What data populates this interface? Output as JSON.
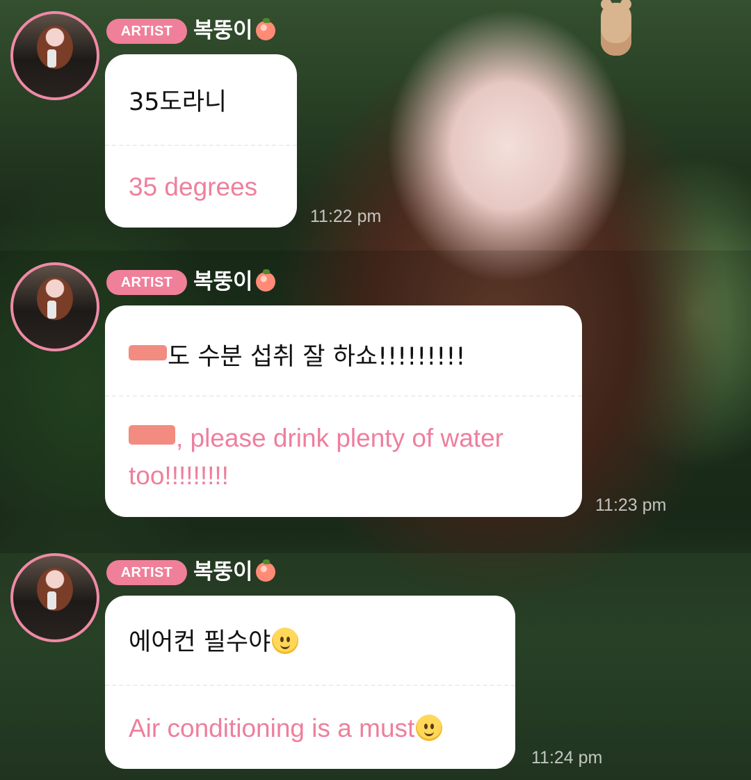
{
  "messages": [
    {
      "badge": "ARTIST",
      "nickname": "복뚱이",
      "original": "35도라니",
      "translation": "35 degrees",
      "timestamp": "11:22 pm"
    },
    {
      "badge": "ARTIST",
      "nickname": "복뚱이",
      "original": "도 수분 섭취 잘 하쇼!!!!!!!!!",
      "translation": ", please drink plenty of water too!!!!!!!!!",
      "timestamp": "11:23 pm"
    },
    {
      "badge": "ARTIST",
      "nickname": "복뚱이",
      "original": "에어컨 필수야",
      "translation": "Air conditioning is a must",
      "timestamp": "11:24 pm"
    }
  ],
  "icons": {
    "nickname_icon": "peach-icon",
    "emoji": "melting-face-icon"
  },
  "colors": {
    "accent": "#f07f9a",
    "translation": "#ee7f9c",
    "bubble": "#ffffff"
  }
}
